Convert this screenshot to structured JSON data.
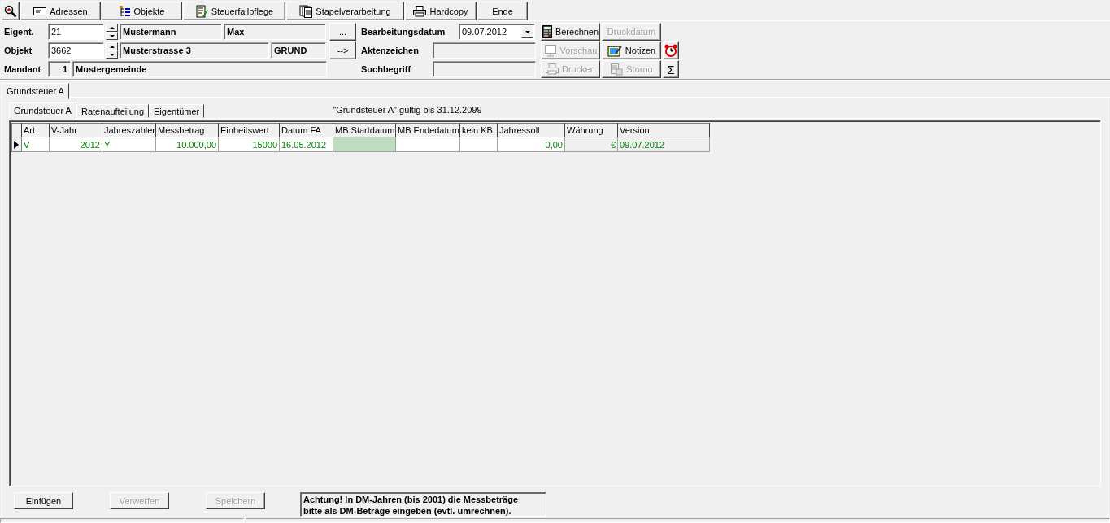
{
  "toolbar": {
    "buttons": [
      {
        "label": "Adressen"
      },
      {
        "label": "Objekte"
      },
      {
        "label": "Steuerfallpflege"
      },
      {
        "label": "Stapelverarbeitung"
      },
      {
        "label": "Hardcopy"
      },
      {
        "label": "Ende"
      }
    ]
  },
  "owner": {
    "label": "Eigent.",
    "number": "21",
    "last_name": "Mustermann",
    "first_name": "Max",
    "button": "..."
  },
  "object": {
    "label": "Objekt",
    "number": "3662",
    "street": "Musterstrasse 3",
    "type": "GRUND",
    "button": "-->"
  },
  "client": {
    "label": "Mandant",
    "number": "1",
    "name": "Mustergemeinde"
  },
  "processing_date": {
    "label": "Bearbeitungsdatum",
    "value": "09.07.2012"
  },
  "file_reference": {
    "label": "Aktenzeichen"
  },
  "search_term": {
    "label": "Suchbegriff"
  },
  "actions": [
    {
      "label": "Berechnen",
      "disabled": false
    },
    {
      "label": "Druckdatum",
      "disabled": true
    },
    {
      "label": "Vorschau",
      "disabled": true
    },
    {
      "label": "Notizen",
      "disabled": false
    },
    {
      "label": "Drucken",
      "disabled": true
    },
    {
      "label": "Storno",
      "disabled": true
    }
  ],
  "sigma_button": "Σ",
  "outer_tabs": [
    {
      "label": "Grundsteuer A",
      "selected": true
    }
  ],
  "inner_tabs": [
    {
      "label": "Grundsteuer A",
      "selected": true
    },
    {
      "label": "Ratenaufteilung",
      "selected": false
    },
    {
      "label": "Eigentümer",
      "selected": false
    }
  ],
  "validity_note": "\"Grundsteuer A\" gültig bis 31.12.2099",
  "table": {
    "columns": [
      "Art",
      "V-Jahr",
      "Jahreszahler",
      "Messbetrag",
      "Einheitswert",
      "Datum FA",
      "MB Startdatum",
      "MB Endedatum",
      "kein KB",
      "Jahressoll",
      "Währung",
      "Version"
    ],
    "rows": [
      {
        "selected": true,
        "cells": [
          {
            "text": "V",
            "kind": "input"
          },
          {
            "text": "2012",
            "kind": "input"
          },
          {
            "text": "Y",
            "kind": "input"
          },
          {
            "text": "10.000,00",
            "kind": "input"
          },
          {
            "text": "15000",
            "kind": "input"
          },
          {
            "text": "16.05.2012",
            "kind": "input"
          },
          {
            "kind": "highlight"
          },
          {
            "kind": "input"
          },
          {
            "kind": "input"
          },
          {
            "text": "0,00",
            "kind": "input"
          },
          {
            "text": "€",
            "kind": "readonly"
          },
          {
            "text": "09.07.2012",
            "kind": "readonly"
          }
        ]
      }
    ]
  },
  "footer_buttons": [
    {
      "label": "Einfügen",
      "disabled": false
    },
    {
      "label": "Verwerfen",
      "disabled": true
    },
    {
      "label": "Speichern",
      "disabled": true
    }
  ],
  "warning_lines": [
    "Achtung! In DM-Jahren (bis 2001) die Messbeträge",
    "bitte als DM-Beträge eingeben (evtl. umrechnen)."
  ]
}
